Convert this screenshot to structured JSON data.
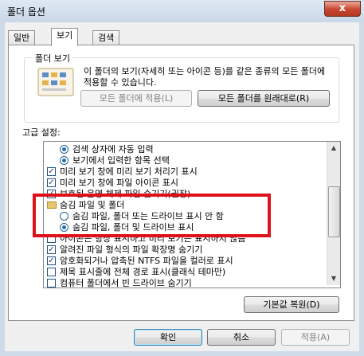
{
  "window": {
    "title": "폴더 옵션",
    "close_glyph": "x"
  },
  "tabs": [
    {
      "label": "일반"
    },
    {
      "label": "보기"
    },
    {
      "label": "검색"
    }
  ],
  "folder_views": {
    "group_label": "폴더 보기",
    "description": "이 폴더의 보기(자세히 또는 아이콘 등)를 같은 종류의 모든 폴더에 적용할 수 있습니다.",
    "apply_button": "모든 폴더에 적용(L)",
    "reset_button": "모든 폴더를 원래대로(R)"
  },
  "advanced": {
    "label": "고급 설정:",
    "items": [
      {
        "type": "radio",
        "checked": true,
        "text": "검색 상자에 자동 입력"
      },
      {
        "type": "radio",
        "checked": true,
        "text": "보기에서 입력한 항목 선택"
      },
      {
        "type": "checkbox",
        "checked": true,
        "text": "미리 보기 창에 미리 보기 처리기 표시"
      },
      {
        "type": "checkbox",
        "checked": true,
        "text": "미리 보기 창에 파일 아이콘 표시"
      },
      {
        "type": "checkbox",
        "checked": true,
        "text": "보호된 운영 체제 파일 숨기기(권장)"
      },
      {
        "type": "folder",
        "text": "숨김 파일 및 폴더"
      },
      {
        "type": "radio",
        "checked": false,
        "text": "숨김 파일, 폴더 또는 드라이브 표시 안 함"
      },
      {
        "type": "radio",
        "checked": true,
        "text": "숨김 파일, 폴더 및 드라이브 표시"
      },
      {
        "type": "checkbox",
        "checked": false,
        "text": "아이콘은 항상 표시하고 미리 보기는 표시하지 않음"
      },
      {
        "type": "checkbox",
        "checked": true,
        "text": "알려진 파일 형식의 파일 확장명 숨기기"
      },
      {
        "type": "checkbox",
        "checked": true,
        "text": "암호화되거나 압축된 NTFS 파일을 컬러로 표시"
      },
      {
        "type": "checkbox",
        "checked": false,
        "text": "제목 표시줄에 전체 경로 표시(클래식 테마만)"
      },
      {
        "type": "checkbox",
        "checked": false,
        "text": "컴퓨터 폴더에서 빈 드라이브 숨기기"
      }
    ],
    "restore_button": "기본값 복원(D)"
  },
  "footer": {
    "ok": "확인",
    "cancel": "취소",
    "apply": "적용(A)"
  },
  "colors": {
    "highlight_box": "#e0101a"
  }
}
